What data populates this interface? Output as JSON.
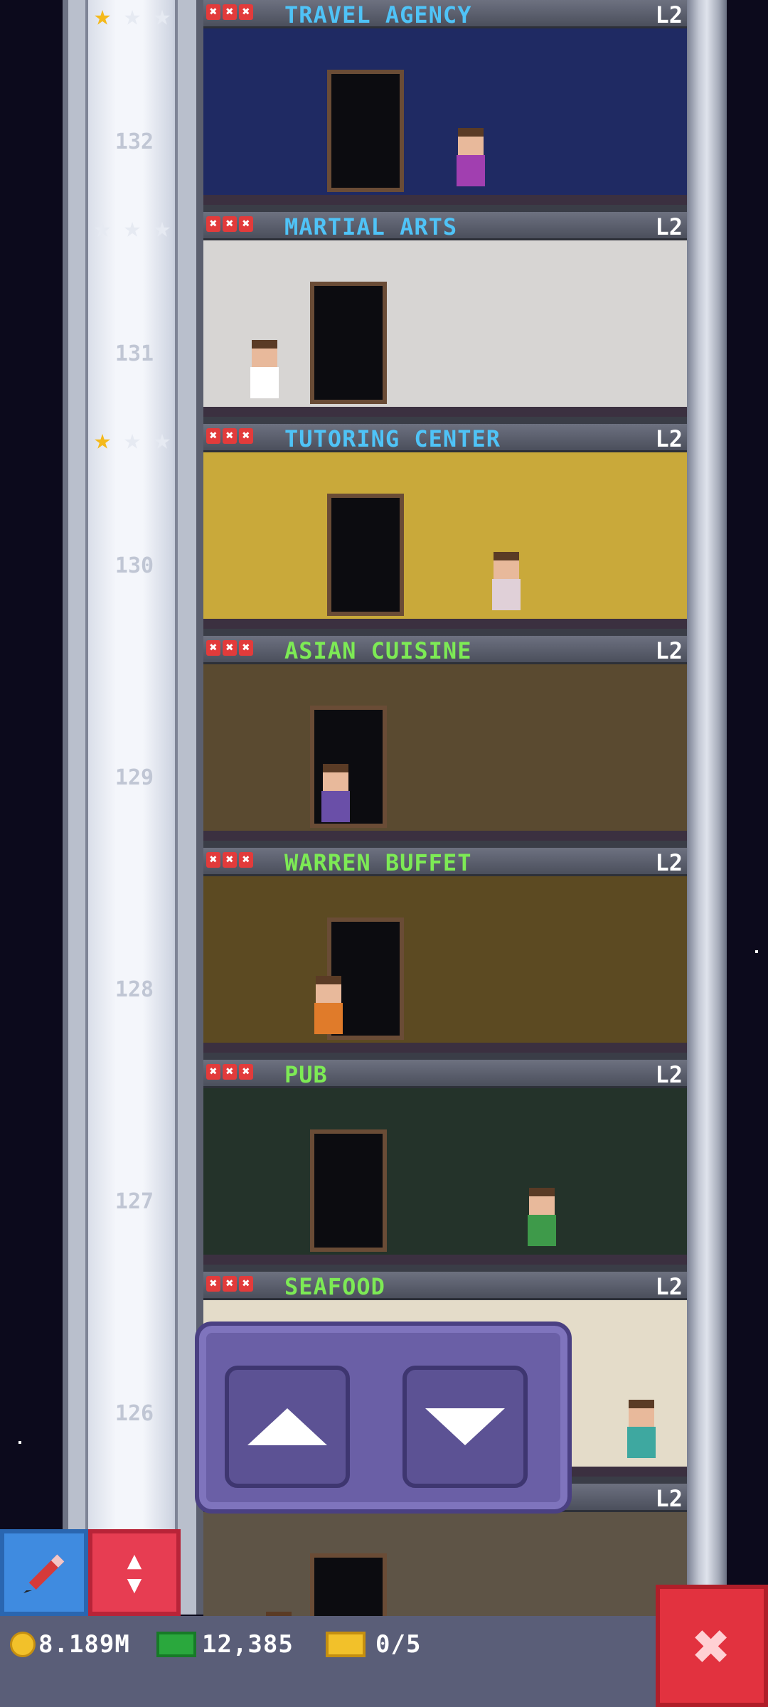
{
  "floors": [
    {
      "number": "132",
      "name": "TRAVEL AGENCY",
      "level": "L2",
      "gold_stars": 1,
      "name_color": "#4fc3f7",
      "room_bg": "#1f2a63"
    },
    {
      "number": "131",
      "name": "MARTIAL ARTS",
      "level": "L2",
      "gold_stars": 0,
      "name_color": "#4fc3f7",
      "room_bg": "#d7d5d3"
    },
    {
      "number": "130",
      "name": "TUTORING CENTER",
      "level": "L2",
      "gold_stars": 1,
      "name_color": "#4fc3f7",
      "room_bg": "#c9a93a"
    },
    {
      "number": "129",
      "name": "ASIAN CUISINE",
      "level": "L2",
      "gold_stars": 0,
      "name_color": "#7dea55",
      "room_bg": "#5a4a30"
    },
    {
      "number": "128",
      "name": "WARREN BUFFET",
      "level": "L2",
      "gold_stars": 0,
      "name_color": "#7dea55",
      "room_bg": "#5c4a22"
    },
    {
      "number": "127",
      "name": "PUB",
      "level": "L2",
      "gold_stars": 0,
      "name_color": "#7dea55",
      "room_bg": "#24332a"
    },
    {
      "number": "126",
      "name": "SEAFOOD",
      "level": "L2",
      "gold_stars": 0,
      "name_color": "#7dea55",
      "room_bg": "#e4dcc9"
    },
    {
      "number": "",
      "name": "",
      "level": "L2",
      "gold_stars": 0,
      "name_color": "#7dea55",
      "room_bg": "#5e5446"
    }
  ],
  "x_mark_symbol": "✖",
  "star_symbol": "★",
  "status": {
    "coins": "8.189M",
    "bux": "12,385",
    "tickets": "0/5"
  },
  "icons": {
    "tool": "pencil-icon",
    "elevator_toggle": "up-down-arrows-icon",
    "close": "close-icon"
  },
  "close_symbol": "✖",
  "toggle_up": "▲",
  "toggle_down": "▼"
}
